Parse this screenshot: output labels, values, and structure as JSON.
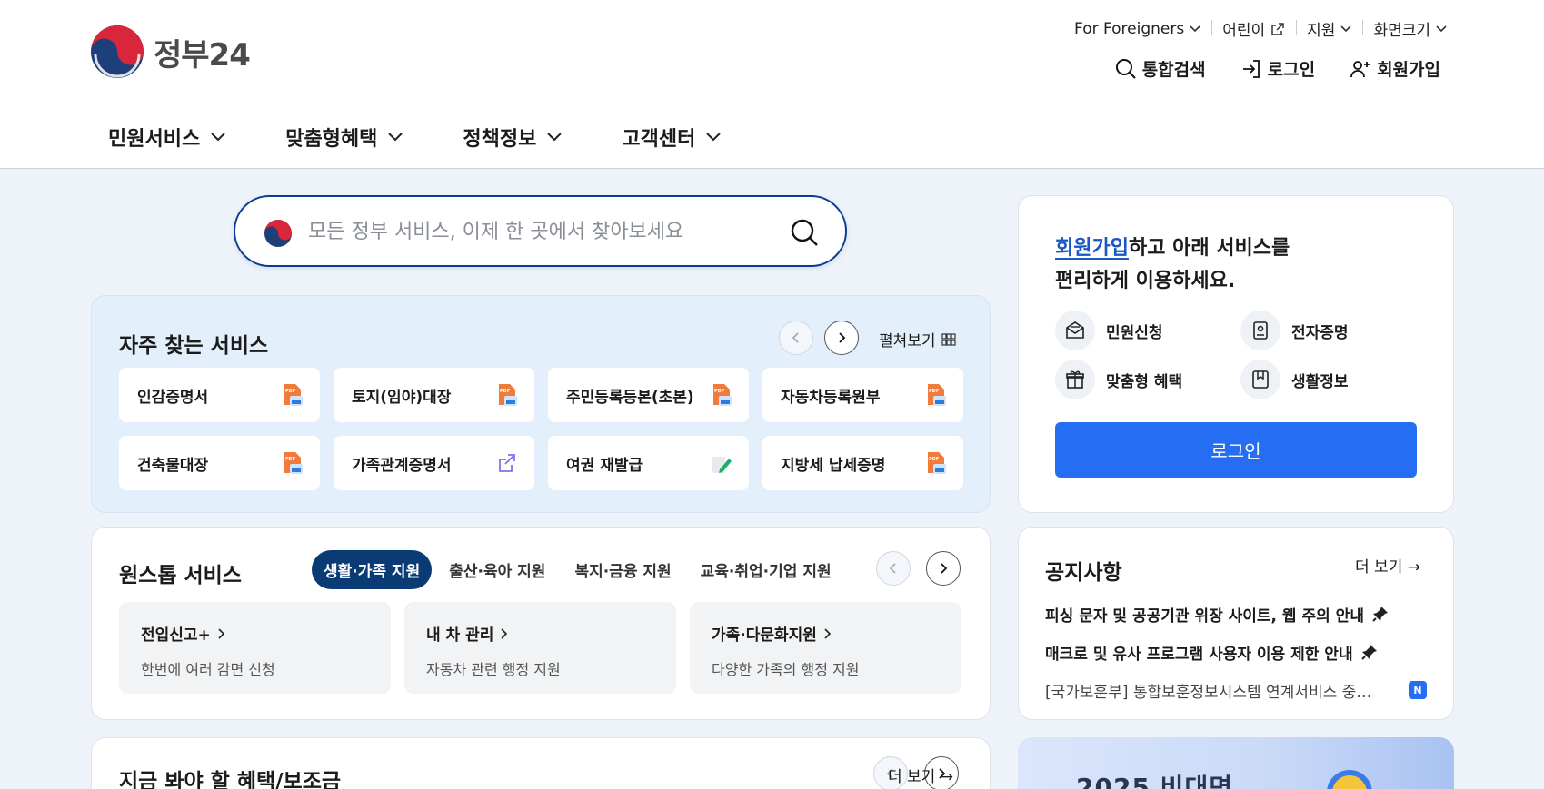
{
  "header": {
    "logo_text": "정부24",
    "util": [
      {
        "label": "For Foreigners"
      },
      {
        "label": "어린이"
      },
      {
        "label": "지원"
      },
      {
        "label": "화면크기"
      }
    ],
    "auth": {
      "search": "통합검색",
      "login": "로그인",
      "signup": "회원가입"
    }
  },
  "gnb": [
    "민원서비스",
    "맞춤형혜택",
    "정책정보",
    "고객센터"
  ],
  "search": {
    "placeholder": "모든 정부 서비스, 이제 한 곳에서 찾아보세요"
  },
  "frequent": {
    "title": "자주 찾는 서비스",
    "expand_label": "펼쳐보기",
    "items": [
      {
        "label": "인감증명서",
        "icon": "pdf-doc-icon"
      },
      {
        "label": "토지(임야)대장",
        "icon": "pdf-doc-icon"
      },
      {
        "label": "주민등록등본(초본)",
        "icon": "pdf-doc-icon"
      },
      {
        "label": "자동차등록원부",
        "icon": "pdf-doc-icon"
      },
      {
        "label": "건축물대장",
        "icon": "pdf-doc-icon"
      },
      {
        "label": "가족관계증명서",
        "icon": "external-link-icon"
      },
      {
        "label": "여권 재발급",
        "icon": "edit-doc-icon"
      },
      {
        "label": "지방세 납세증명",
        "icon": "pdf-doc-icon"
      }
    ]
  },
  "onestop": {
    "title": "원스톱 서비스",
    "tabs": [
      "생활·가족 지원",
      "출산·육아 지원",
      "복지·금융 지원",
      "교육·취업·기업 지원"
    ],
    "active_tab": 0,
    "cards": [
      {
        "title": "전입신고+",
        "desc": "한번에 여러 감면 신청"
      },
      {
        "title": "내 차 관리",
        "desc": "자동차 관련 행정 지원"
      },
      {
        "title": "가족·다문화지원",
        "desc": "다양한 가족의 행정 지원"
      }
    ]
  },
  "benefits": {
    "title": "지금 봐야 할 혜택/보조금",
    "more": "더 보기"
  },
  "login_box": {
    "msg_link": "회원가입",
    "msg_rest1": "하고 아래 서비스를",
    "msg_line2": "편리하게 이용하세요.",
    "quick": [
      {
        "label": "민원신청",
        "icon": "envelope-icon"
      },
      {
        "label": "전자증명",
        "icon": "id-badge-icon"
      },
      {
        "label": "맞춤형 혜택",
        "icon": "gift-icon"
      },
      {
        "label": "생활정보",
        "icon": "bookmark-icon"
      }
    ],
    "button": "로그인"
  },
  "notice": {
    "title": "공지사항",
    "more": "더 보기",
    "items": [
      {
        "text": "피싱 문자 및 공공기관 위장 사이트, 웹 주의 안내",
        "pinned": true
      },
      {
        "text": "매크로 및 유사 프로그램 사용자 이용 제한 안내",
        "pinned": true
      },
      {
        "text": "[국가보훈부] 통합보훈정보시스템 연계서비스 중…",
        "badge": "N"
      }
    ]
  },
  "banner": {
    "text": "2025 비대면"
  },
  "colors": {
    "primary": "#256ef4",
    "navy": "#0b3b74",
    "bg": "#eef3f9"
  }
}
